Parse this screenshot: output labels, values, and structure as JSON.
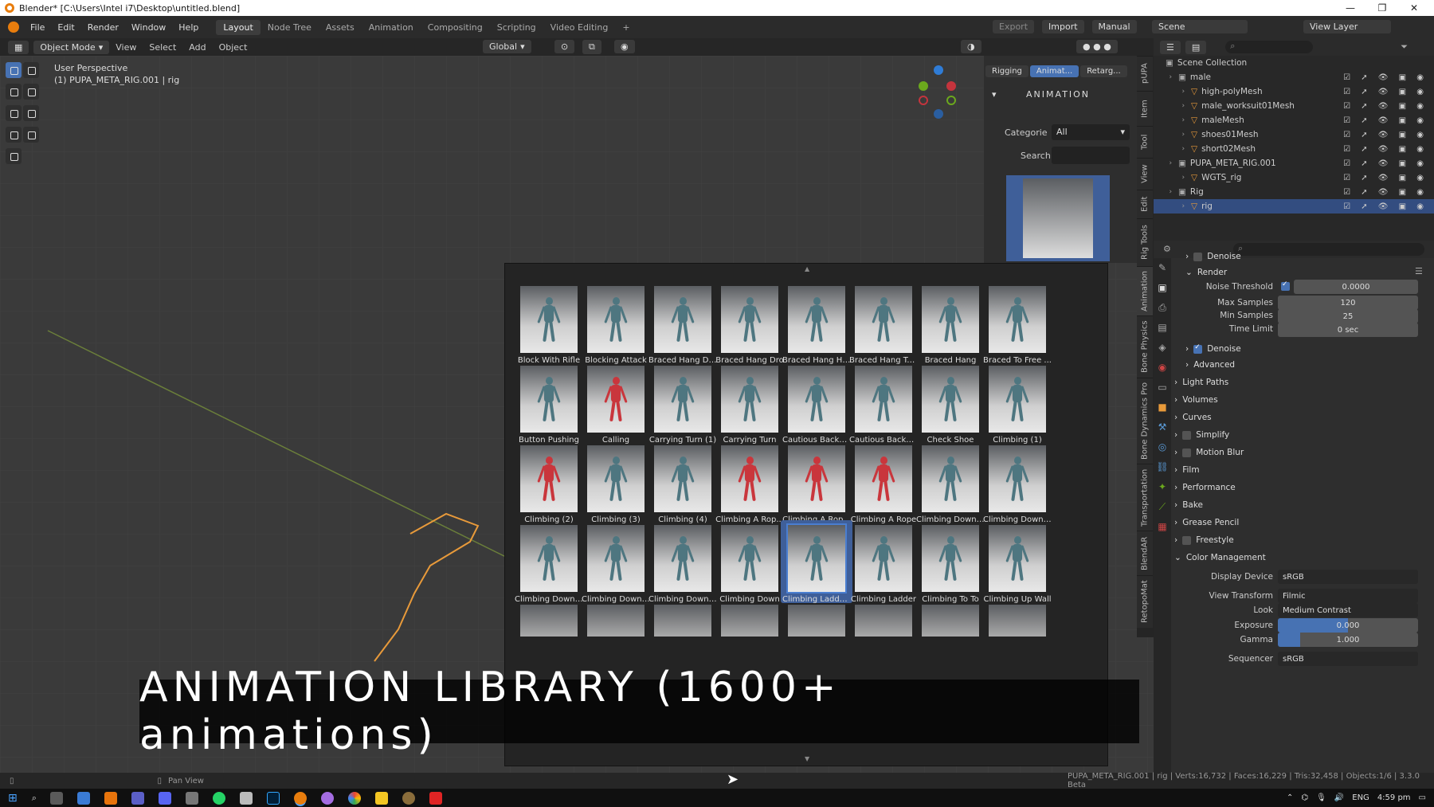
{
  "window": {
    "title": "Blender* [C:\\Users\\Intel i7\\Desktop\\untitled.blend]"
  },
  "menu": {
    "items": [
      "File",
      "Edit",
      "Render",
      "Window",
      "Help"
    ]
  },
  "workspaces": [
    "Layout",
    "Node Tree",
    "Assets",
    "Animation",
    "Compositing",
    "Scripting",
    "Video Editing"
  ],
  "topright": {
    "export": "Export",
    "import": "Import",
    "manual": "Manual",
    "scene": "Scene",
    "view_layer": "View Layer"
  },
  "viewport_header": {
    "mode": "Object Mode",
    "menus": [
      "View",
      "Select",
      "Add",
      "Object"
    ],
    "transform": "Global"
  },
  "viewport": {
    "perspective": "User Perspective",
    "active": "(1) PUPA_META_RIG.001 | rig"
  },
  "npanel": {
    "tabs": [
      "Rigging",
      "Animat...",
      "Retarg..."
    ],
    "section": "ANIMATION",
    "categorie_label": "Categorie",
    "categorie_value": "All",
    "search_label": "Search",
    "vertical_tabs": [
      "pUPA",
      "Item",
      "Tool",
      "View",
      "Edit",
      "Rig Tools",
      "Animation",
      "Bone Physics",
      "Bone Dynamics Pro",
      "Transportation",
      "BlendAR",
      "RetopoMat"
    ]
  },
  "library": {
    "items": [
      {
        "label": "Block With Rifle",
        "color": "teal"
      },
      {
        "label": "Blocking Attack",
        "color": "teal"
      },
      {
        "label": "Braced Hang Dr...",
        "color": "teal"
      },
      {
        "label": "Braced Hang Dro",
        "color": "teal"
      },
      {
        "label": "Braced Hang Ho...",
        "color": "teal"
      },
      {
        "label": "Braced Hang To...",
        "color": "teal"
      },
      {
        "label": "Braced Hang",
        "color": "teal"
      },
      {
        "label": "Braced To Free ...",
        "color": "teal"
      },
      {
        "label": "Button Pushing",
        "color": "teal"
      },
      {
        "label": "Calling",
        "color": "red"
      },
      {
        "label": "Carrying Turn (1)",
        "color": "teal"
      },
      {
        "label": "Carrying Turn",
        "color": "teal"
      },
      {
        "label": "Cautious Backw...",
        "color": "teal"
      },
      {
        "label": "Cautious Backw...",
        "color": "teal"
      },
      {
        "label": "Check Shoe",
        "color": "teal"
      },
      {
        "label": "Climbing (1)",
        "color": "teal"
      },
      {
        "label": "Climbing (2)",
        "color": "red"
      },
      {
        "label": "Climbing (3)",
        "color": "teal"
      },
      {
        "label": "Climbing (4)",
        "color": "teal"
      },
      {
        "label": "Climbing A Rop...",
        "color": "red"
      },
      {
        "label": "Climbing A Rop...",
        "color": "red"
      },
      {
        "label": "Climbing A Rope",
        "color": "red"
      },
      {
        "label": "Climbing Down ...",
        "color": "teal"
      },
      {
        "label": "Climbing Down ...",
        "color": "teal"
      },
      {
        "label": "Climbing Down ...",
        "color": "teal"
      },
      {
        "label": "Climbing Down ...",
        "color": "teal"
      },
      {
        "label": "Climbing Down ...",
        "color": "teal"
      },
      {
        "label": "Climbing Down",
        "color": "teal"
      },
      {
        "label": "Climbing Ladder...",
        "color": "teal",
        "selected": true
      },
      {
        "label": "Climbing Ladder",
        "color": "teal"
      },
      {
        "label": "Climbing To To",
        "color": "teal"
      },
      {
        "label": "Climbing Up Wall",
        "color": "teal"
      }
    ]
  },
  "outliner": {
    "rows": [
      {
        "label": "Scene Collection",
        "indent": 0
      },
      {
        "label": "male",
        "indent": 1
      },
      {
        "label": "high-polyMesh",
        "indent": 2
      },
      {
        "label": "male_worksuit01Mesh",
        "indent": 2
      },
      {
        "label": "maleMesh",
        "indent": 2
      },
      {
        "label": "shoes01Mesh",
        "indent": 2
      },
      {
        "label": "short02Mesh",
        "indent": 2
      },
      {
        "label": "PUPA_META_RIG.001",
        "indent": 1
      },
      {
        "label": "WGTS_rig",
        "indent": 2
      },
      {
        "label": "Rig",
        "indent": 1
      },
      {
        "label": "rig",
        "indent": 2,
        "selected": true
      }
    ]
  },
  "properties": {
    "denoise1": "Denoise",
    "render": "Render",
    "noise_threshold_label": "Noise Threshold",
    "noise_threshold": "0.0000",
    "max_samples_label": "Max Samples",
    "max_samples": "120",
    "min_samples_label": "Min Samples",
    "min_samples": "25",
    "time_limit_label": "Time Limit",
    "time_limit": "0 sec",
    "denoise2": "Denoise",
    "advanced": "Advanced",
    "sections": [
      "Light Paths",
      "Volumes",
      "Curves",
      "Simplify",
      "Motion Blur",
      "Film",
      "Performance",
      "Bake",
      "Grease Pencil",
      "Freestyle",
      "Color Management"
    ],
    "display_device_label": "Display Device",
    "display_device": "sRGB",
    "view_transform_label": "View Transform",
    "view_transform": "Filmic",
    "look_label": "Look",
    "look": "Medium Contrast",
    "exposure_label": "Exposure",
    "exposure": "0.000",
    "gamma_label": "Gamma",
    "gamma": "1.000",
    "sequencer_label": "Sequencer",
    "sequencer": "sRGB"
  },
  "status": {
    "pan": "Pan View",
    "stats": "PUPA_META_RIG.001 | rig | Verts:16,732 | Faces:16,229 | Tris:32,458 | Objects:1/6 | 3.3.0 Beta"
  },
  "taskbar": {
    "lang": "ENG",
    "time": "4:59 pm"
  },
  "banner": "ANIMATION LIBRARY (1600+ animations)"
}
